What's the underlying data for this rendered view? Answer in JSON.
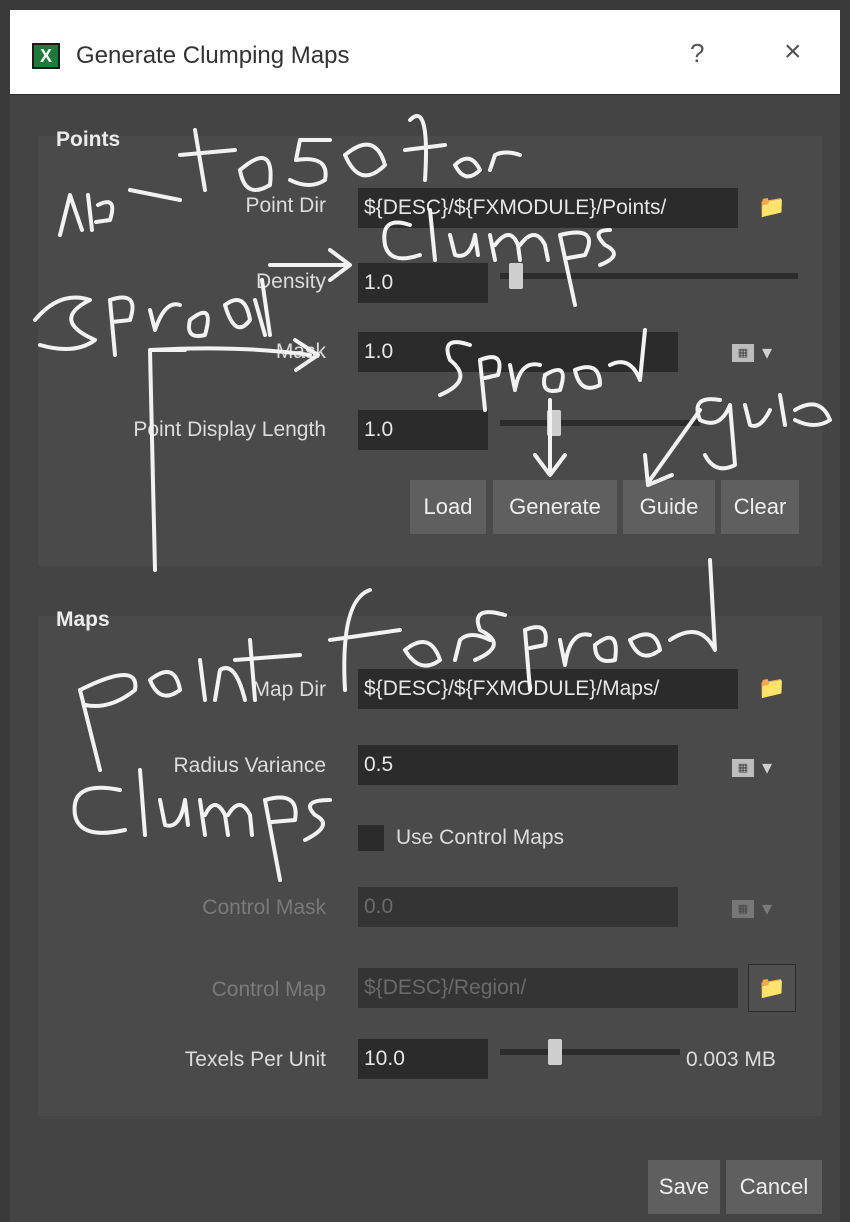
{
  "window": {
    "title": "Generate Clumping Maps",
    "app_icon": "X",
    "help_glyph": "?",
    "close_glyph": "×"
  },
  "points": {
    "group_title": "Points",
    "point_dir_label": "Point Dir",
    "point_dir_value": "${DESC}/${FXMODULE}/Points/",
    "density_label": "Density",
    "density_value": "1.0",
    "density_slider": 0.02,
    "mask_label": "Mask",
    "mask_value": "1.0",
    "display_length_label": "Point Display Length",
    "display_length_value": "1.0",
    "display_length_slider": 0.22,
    "buttons": {
      "load": "Load",
      "generate": "Generate",
      "guide": "Guide",
      "clear": "Clear"
    }
  },
  "maps": {
    "group_title": "Maps",
    "map_dir_label": "Map Dir",
    "map_dir_value": "${DESC}/${FXMODULE}/Maps/",
    "radius_variance_label": "Radius Variance",
    "radius_variance_value": "0.5",
    "use_control_maps_label": "Use Control Maps",
    "use_control_maps_checked": false,
    "control_mask_label": "Control Mask",
    "control_mask_value": "0.0",
    "control_map_label": "Control Map",
    "control_map_value": "${DESC}/Region/",
    "texels_label": "Texels Per Unit",
    "texels_value": "10.0",
    "texels_slider": 0.25,
    "memory_text": "0.003 MB"
  },
  "footer": {
    "save": "Save",
    "cancel": "Cancel"
  },
  "annotations": {
    "note_1": "up to 50 for spread clumps",
    "note_2": "spread",
    "note_3": "guide",
    "note_4": "point for spread clumps"
  },
  "icons": {
    "folder": "folder-icon",
    "texture_map": "texture-map-icon",
    "dropdown": "dropdown-arrow-icon"
  },
  "colors": {
    "background": "#444444",
    "group": "#4a4a4a",
    "field": "#2b2b2b",
    "button": "#5f5f5f",
    "ink": "#f2f2f2"
  }
}
